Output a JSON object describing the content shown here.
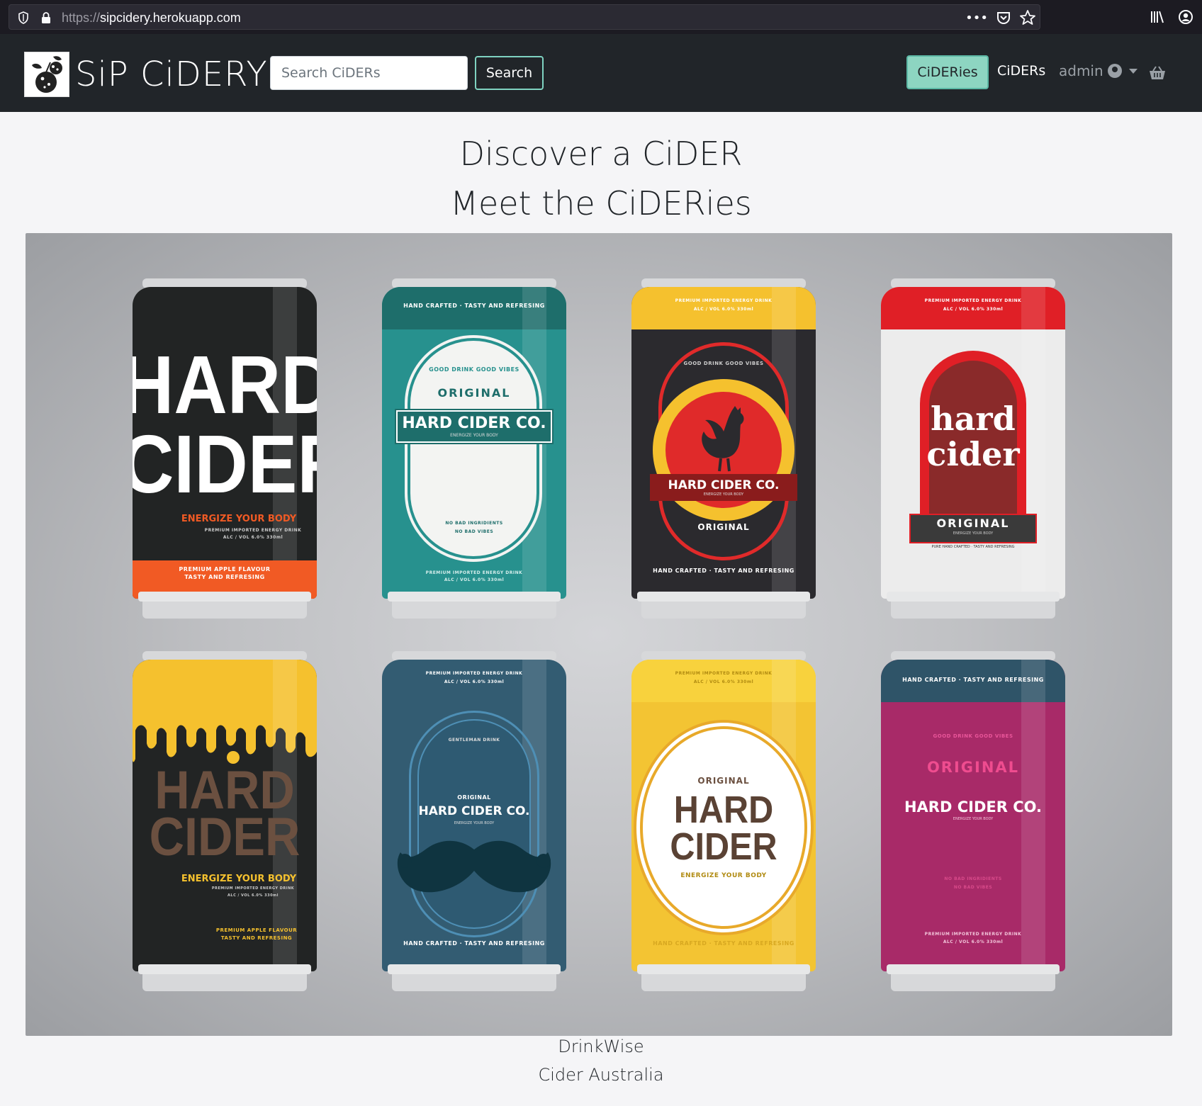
{
  "browser": {
    "url_protocol": "https://",
    "url_host": "sipcidery.herokuapp.com",
    "icons": [
      "shield-icon",
      "lock-icon",
      "more-icon",
      "pocket-icon",
      "bookmark-star-icon",
      "library-icon",
      "account-icon"
    ]
  },
  "navbar": {
    "brand": "SiP CiDERY",
    "search_placeholder": "Search CiDERs",
    "search_button": "Search",
    "links": {
      "cideries": "CiDERies",
      "ciders": "CiDERs",
      "admin": "admin"
    },
    "colors": {
      "background": "#212529",
      "accent": "#8dd5c1"
    }
  },
  "main": {
    "heading_line1": "Discover a CiDER",
    "heading_line2": "Meet the CiDERies"
  },
  "hero_cans": [
    {
      "lines": [
        "HARD",
        "CIDER",
        "ENERGIZE YOUR BODY",
        "PREMIUM IMPORTED ENERGY DRINK",
        "ALC / VOL 6.0% 330ml",
        "PREMIUM APPLE FLAVOUR",
        "TASTY AND REFRESING"
      ]
    },
    {
      "lines": [
        "HAND CRAFTED · TASTY AND REFRESING",
        "GOOD DRINK GOOD VIBES",
        "ORIGINAL",
        "HARD CIDER CO.",
        "ENERGIZE YOUR BODY",
        "NO BAD INGRIDIENTS",
        "NO BAD VIBES",
        "PREMIUM IMPORTED ENERGY DRINK",
        "ALC / VOL 6.0% 330ml"
      ]
    },
    {
      "lines": [
        "PREMIUM IMPORTED ENERGY DRINK",
        "ALC / VOL 6.0% 330ml",
        "GOOD DRINK GOOD VIBES",
        "HARD CIDER CO.",
        "ENERGIZE YOUR BODY",
        "ORIGINAL",
        "HAND CRAFTED · TASTY AND REFRESING"
      ]
    },
    {
      "lines": [
        "PREMIUM IMPORTED ENERGY DRINK",
        "ALC / VOL 6.0% 330ml",
        "hard",
        "cider",
        "ORIGINAL",
        "ENERGIZE YOUR BODY",
        "PURE HAND CRAFTED · TASTY AND REFRESING"
      ]
    },
    {
      "lines": [
        "HARD",
        "CIDER",
        "ENERGIZE YOUR BODY",
        "PREMIUM IMPORTED ENERGY DRINK",
        "ALC / VOL 6.0% 330ml",
        "PREMIUM APPLE FLAVOUR",
        "TASTY AND REFRESING"
      ]
    },
    {
      "lines": [
        "PREMIUM IMPORTED ENERGY DRINK",
        "ALC / VOL 6.0% 330ml",
        "GENTLEMAN DRINK",
        "ORIGINAL",
        "HARD CIDER CO.",
        "ENERGIZE YOUR BODY",
        "HAND CRAFTED · TASTY AND REFRESING"
      ]
    },
    {
      "lines": [
        "PREMIUM IMPORTED ENERGY DRINK",
        "ALC / VOL 6.0% 330ml",
        "ORIGINAL",
        "HARD",
        "CIDER",
        "ENERGIZE YOUR BODY",
        "HAND CRAFTED · TASTY AND REFRESING"
      ]
    },
    {
      "lines": [
        "HAND CRAFTED · TASTY AND REFRESING",
        "GOOD DRINK GOOD VIBES",
        "ORIGINAL",
        "HARD CIDER CO.",
        "ENERGIZE YOUR BODY",
        "NO BAD INGRIDIENTS",
        "NO BAD VIBES",
        "PREMIUM IMPORTED ENERGY DRINK",
        "ALC / VOL 6.0% 330ml"
      ]
    }
  ],
  "footer": {
    "line1": "DrinkWise",
    "line2": "Cider Australia"
  }
}
